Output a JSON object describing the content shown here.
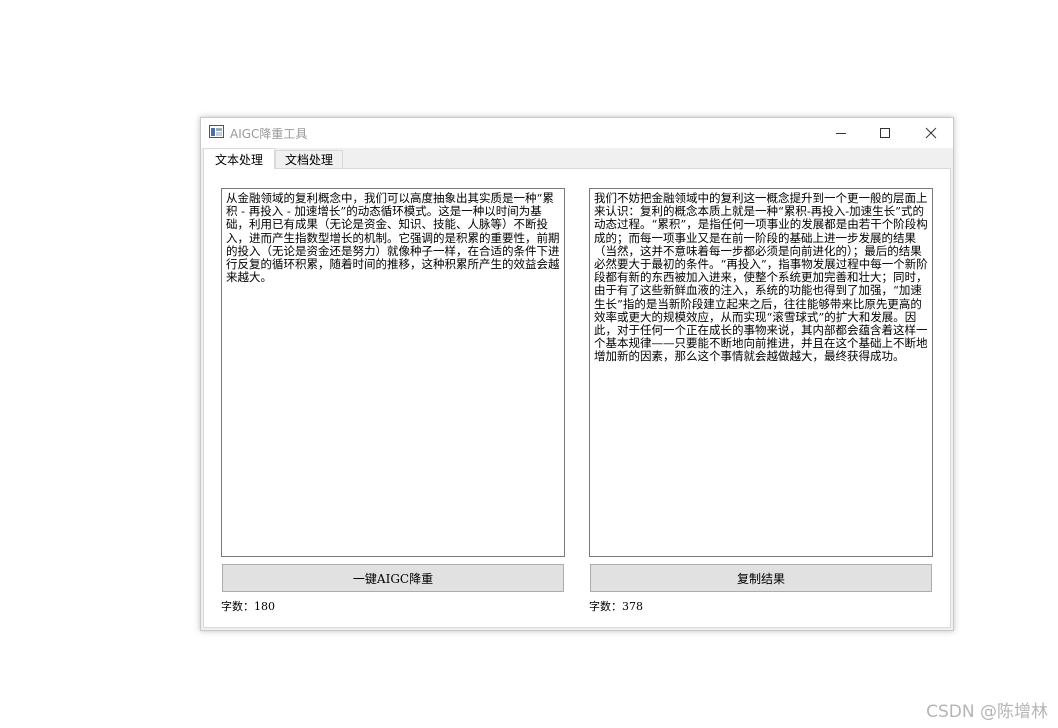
{
  "window": {
    "title": "AIGC降重工具"
  },
  "tabs": [
    {
      "label": "文本处理",
      "active": true
    },
    {
      "label": "文档处理",
      "active": false
    }
  ],
  "left_panel": {
    "text": "从金融领域的复利概念中，我们可以高度抽象出其实质是一种“累积 - 再投入 - 加速增长”的动态循环模式。这是一种以时间为基础，利用已有成果（无论是资金、知识、技能、人脉等）不断投入，进而产生指数型增长的机制。它强调的是积累的重要性，前期的投入（无论是资金还是努力）就像种子一样，在合适的条件下进行反复的循环积累，随着时间的推移，这种积累所产生的效益会越来越大。",
    "button_label": "一键AIGC降重",
    "count_label": "字数：180"
  },
  "right_panel": {
    "text": "我们不妨把金融领域中的复利这一概念提升到一个更一般的层面上来认识：复利的概念本质上就是一种“累积-再投入-加速生长”式的动态过程。“累积”，是指任何一项事业的发展都是由若干个阶段构成的；而每一项事业又是在前一阶段的基础上进一步发展的结果（当然，这并不意味着每一步都必须是向前进化的）；最后的结果必然要大于最初的条件。“再投入”，指事物发展过程中每一个新阶段都有新的东西被加入进来，使整个系统更加完善和壮大；同时，由于有了这些新鲜血液的注入，系统的功能也得到了加强，“加速生长”指的是当新阶段建立起来之后，往往能够带来比原先更高的效率或更大的规模效应，从而实现“滚雪球式”的扩大和发展。因此，对于任何一个正在成长的事物来说，其内部都会蕴含着这样一个基本规律——只要能不断地向前推进，并且在这个基础上不断地增加新的因素，那么这个事情就会越做越大，最终获得成功。",
    "button_label": "复制结果",
    "count_label": "字数：378"
  },
  "watermark": "CSDN @陈增林"
}
